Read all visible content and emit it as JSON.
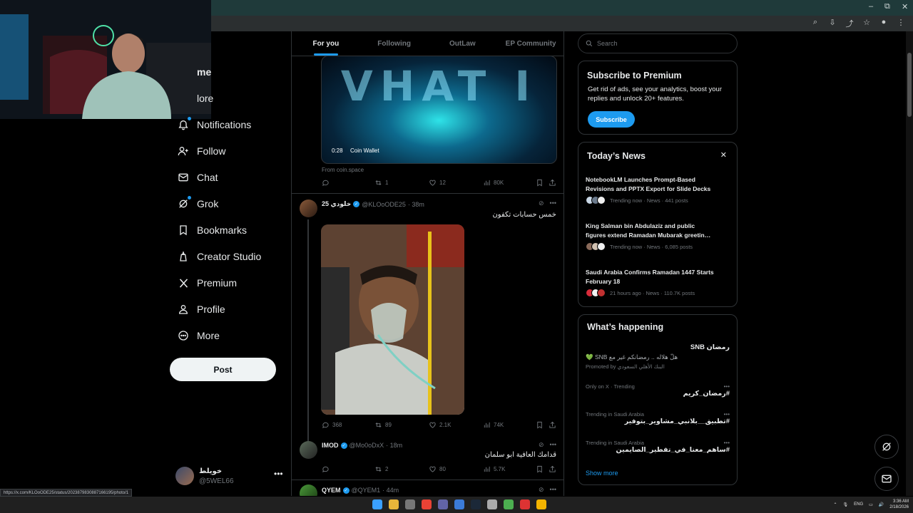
{
  "browser": {
    "controls": [
      "–",
      "⧉",
      "✕"
    ]
  },
  "nav": {
    "items": [
      {
        "label": "me",
        "icon": "home-icon"
      },
      {
        "label": "lore",
        "icon": "search-icon"
      },
      {
        "label": "Notifications",
        "icon": "bell-icon"
      },
      {
        "label": "Follow",
        "icon": "follow-icon"
      },
      {
        "label": "Chat",
        "icon": "chat-icon"
      },
      {
        "label": "Grok",
        "icon": "grok-icon"
      },
      {
        "label": "Bookmarks",
        "icon": "bookmark-icon"
      },
      {
        "label": "Creator Studio",
        "icon": "creator-studio-icon"
      },
      {
        "label": "Premium",
        "icon": "x-logo-icon"
      },
      {
        "label": "Profile",
        "icon": "person-icon"
      },
      {
        "label": "More",
        "icon": "more-circle-icon"
      }
    ],
    "post_label": "Post",
    "account": {
      "name": "خويلط",
      "handle": "@5WEL66"
    }
  },
  "status_url": "https://x.com/KLOoODE25/status/2023879830887166195/photo/1",
  "timeline": {
    "tabs": [
      "For you",
      "Following",
      "OutLaw",
      "EP Community"
    ],
    "active_tab": "For you",
    "tweet1": {
      "video_overlay_text": "VHAT I",
      "video_time": "0:28",
      "video_label": "Coin Wallet",
      "from": "From coin.space",
      "stats": {
        "replies": "",
        "reposts": "1",
        "likes": "12",
        "views": "80K"
      }
    },
    "tweet2": {
      "name": "خلودي 25",
      "handle": "@KLOoODE25",
      "time": "· 38m",
      "text": "خمس حسابات تكفون",
      "stats": {
        "replies": "368",
        "reposts": "89",
        "likes": "2.1K",
        "views": "74K"
      }
    },
    "tweet3": {
      "name": "IMOD",
      "handle": "@Mo0oDxX",
      "time": "· 18m",
      "text": "قدامك العافية ابو سلمان",
      "stats": {
        "replies": "",
        "reposts": "2",
        "likes": "80",
        "views": "5.7K"
      }
    },
    "tweet4": {
      "name": "QYEM",
      "handle": "@QYEM1",
      "time": "· 44m"
    }
  },
  "sidebar": {
    "search_placeholder": "Search",
    "premium": {
      "title": "Subscribe to Premium",
      "body_line1": "Get rid of ads, see your analytics, boost your",
      "body_line2": "replies and unlock 20+ features.",
      "button": "Subscribe"
    },
    "news": {
      "title": "Today’s News",
      "items": [
        {
          "headline_l1": "NotebookLM Launches Prompt-Based",
          "headline_l2": "Revisions and PPTX Export for Slide Decks",
          "meta": "Trending now · News · 441 posts"
        },
        {
          "headline_l1": "King Salman bin Abdulaziz and public",
          "headline_l2": "figures extend Ramadan Mubarak greetin…",
          "meta": "Trending now · News · 6,085 posts"
        },
        {
          "headline_l1": "Saudi Arabia Confirms Ramadan 1447 Starts",
          "headline_l2": "February 18",
          "meta": "21 hours ago · News · 110.7K posts"
        }
      ]
    },
    "happening": {
      "title": "What’s happening",
      "promo": {
        "title": "رمضان SNB",
        "line": "هلّ هلاله .. رمضانكم غير مع SNB 💚",
        "promoted": "Promoted by البنك الأهلي السعودي"
      },
      "trends": [
        {
          "context": "Only on X · Trending",
          "tag": "#رمضان_كريم"
        },
        {
          "context": "Trending in Saudi Arabia",
          "tag": "#تطبيق__بلانبي_مشاوير_بتوفير"
        },
        {
          "context": "Trending in Saudi Arabia",
          "tag": "#ساهم_معنا_في_تفطير_الصايمين"
        }
      ],
      "show_more": "Show more"
    }
  },
  "taskbar": {
    "lang": "ENG",
    "time": "3:36 AM",
    "date": "2/18/2026"
  },
  "colors": {
    "accent": "#1d9bf0",
    "background": "#000000",
    "text": "#e7e9ea",
    "muted": "#71767b",
    "border": "#2f3336"
  }
}
